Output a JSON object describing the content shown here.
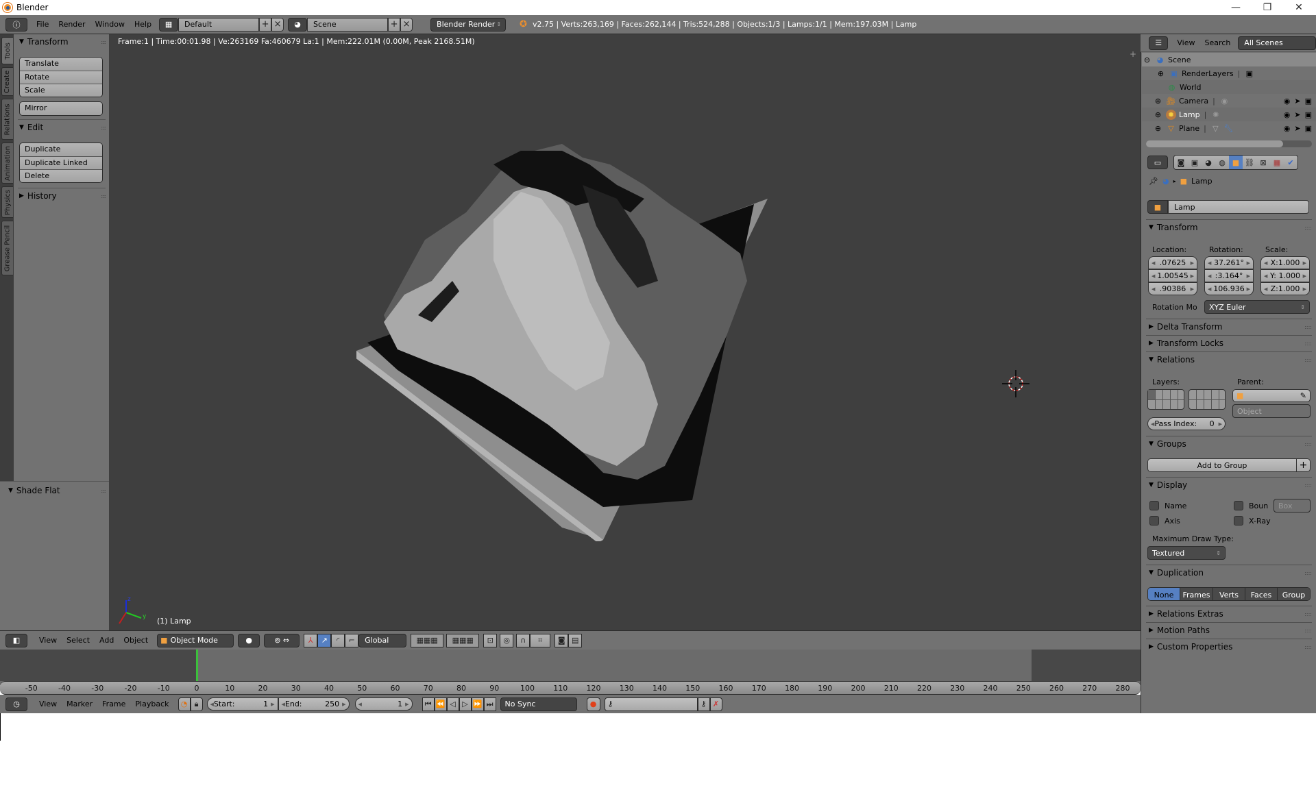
{
  "window": {
    "title": "Blender",
    "minimize": "—",
    "maximize": "❐",
    "close": "✕"
  },
  "info_header": {
    "menus": [
      "File",
      "Render",
      "Window",
      "Help"
    ],
    "screen_layout": "Default",
    "scene": "Scene",
    "render_engine": "Blender Render",
    "stats": "v2.75 | Verts:263,169 | Faces:262,144 | Tris:524,288 | Objects:1/3 | Lamps:1/1 | Mem:197.03M | Lamp"
  },
  "tool_shelf": {
    "tabs": [
      "Tools",
      "Create",
      "Relations",
      "Animation",
      "Physics",
      "Grease Pencil"
    ],
    "active_tab": "Tools",
    "transform": {
      "title": "Transform",
      "buttons": [
        "Translate",
        "Rotate",
        "Scale"
      ],
      "mirror": "Mirror"
    },
    "edit": {
      "title": "Edit",
      "buttons": [
        "Duplicate",
        "Duplicate Linked",
        "Delete"
      ]
    },
    "history": {
      "title": "History"
    },
    "operator": {
      "title": "Shade Flat"
    }
  },
  "viewport": {
    "render_stats": "Frame:1 | Time:00:01.98 | Ve:263169 Fa:460679 La:1 | Mem:222.01M (0.00M, Peak 2168.51M)",
    "object_label": "(1) Lamp",
    "axis_labels": {
      "x": "x",
      "y": "y",
      "z": "z"
    }
  },
  "view3d_header": {
    "menus": [
      "View",
      "Select",
      "Add",
      "Object"
    ],
    "mode": "Object Mode",
    "orientation": "Global"
  },
  "timeline": {
    "ticks": [
      -50,
      -40,
      -30,
      -20,
      -10,
      0,
      10,
      20,
      30,
      40,
      50,
      60,
      70,
      80,
      90,
      100,
      110,
      120,
      130,
      140,
      150,
      160,
      170,
      180,
      190,
      200,
      210,
      220,
      230,
      240,
      250,
      260,
      270,
      280
    ],
    "current_frame_marker": 0,
    "menus": [
      "View",
      "Marker",
      "Frame",
      "Playback"
    ],
    "start_label": "Start:",
    "start": "1",
    "end_label": "End:",
    "end": "250",
    "current": "1",
    "sync": "No Sync"
  },
  "outliner": {
    "menus": [
      "View",
      "Search"
    ],
    "filter": "All Scenes",
    "items": [
      {
        "name": "Scene"
      },
      {
        "name": "RenderLayers"
      },
      {
        "name": "World"
      },
      {
        "name": "Camera"
      },
      {
        "name": "Lamp"
      },
      {
        "name": "Plane"
      }
    ]
  },
  "properties": {
    "breadcrumb": "Lamp",
    "object_name": "Lamp",
    "transform": {
      "title": "Transform",
      "location_label": "Location:",
      "rotation_label": "Rotation:",
      "scale_label": "Scale:",
      "location": [
        ".07625",
        "1.00545",
        ".90386"
      ],
      "rotation": [
        "37.261°",
        ":3.164°",
        "106.936"
      ],
      "scale": [
        "X:1.000",
        "Y: 1.000",
        "Z:1.000"
      ],
      "rotation_mode_label": "Rotation Mo",
      "rotation_mode": "XYZ Euler"
    },
    "collapsed_1": [
      "Delta Transform",
      "Transform Locks"
    ],
    "relations": {
      "title": "Relations",
      "layers_label": "Layers:",
      "parent_label": "Parent:",
      "parent_type": "Object",
      "pass_index_label": "Pass Index:",
      "pass_index": "0"
    },
    "groups": {
      "title": "Groups",
      "add_button": "Add to Group"
    },
    "display": {
      "title": "Display",
      "name": "Name",
      "axis": "Axis",
      "bounds": "Boun",
      "bounds_type": "Box",
      "xray": "X-Ray",
      "max_draw_label": "Maximum Draw Type:",
      "max_draw": "Textured"
    },
    "duplication": {
      "title": "Duplication",
      "options": [
        "None",
        "Frames",
        "Verts",
        "Faces",
        "Group"
      ],
      "active": "None"
    },
    "collapsed_2": [
      "Relations Extras",
      "Motion Paths",
      "Custom Properties"
    ]
  },
  "colors": {
    "accent": "#5680c2",
    "header_bg": "#727272",
    "viewport_bg": "#3f3f3f",
    "frame_cursor": "#3cc03c"
  }
}
